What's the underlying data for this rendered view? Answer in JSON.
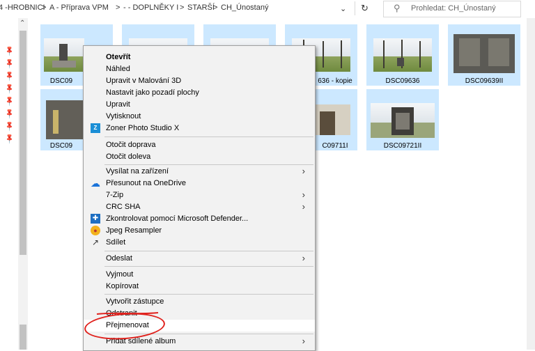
{
  "address_bar": {
    "breadcrumb": [
      "4 -HROBNICI",
      "A - Příprava VPM",
      "- - DOPLNĚKY I",
      "STARŠÍ",
      "CH_Únostaný"
    ],
    "separator": ">",
    "dropdown_icon": "chevron-down-icon",
    "refresh_icon": "refresh-icon",
    "search_placeholder": "Prohledat: CH_Únostaný"
  },
  "files": [
    {
      "name": "DSC09"
    },
    {
      "name": ""
    },
    {
      "name": ""
    },
    {
      "name": "636 - kopie"
    },
    {
      "name": "DSC09636"
    },
    {
      "name": "DSC09639II"
    },
    {
      "name": "DSC09"
    },
    {
      "name": "C09711I"
    },
    {
      "name": "DSC09721II"
    }
  ],
  "context_menu": {
    "items": [
      {
        "label": "Otevřít",
        "bold": true,
        "icon": ""
      },
      {
        "label": "Náhled",
        "icon": ""
      },
      {
        "label": "Upravit v Malování 3D",
        "icon": ""
      },
      {
        "label": "Nastavit jako pozadí plochy",
        "icon": ""
      },
      {
        "label": "Upravit",
        "icon": ""
      },
      {
        "label": "Vytisknout",
        "icon": ""
      },
      {
        "label": "Zoner Photo Studio X",
        "icon": "zoner-icon"
      },
      {
        "label": "Otočit doprava",
        "icon": ""
      },
      {
        "label": "Otočit doleva",
        "icon": ""
      },
      {
        "label": "Vysílat na zařízení",
        "icon": "",
        "submenu": true
      },
      {
        "label": "Přesunout na OneDrive",
        "icon": "onedrive-icon"
      },
      {
        "label": "7-Zip",
        "icon": "",
        "submenu": true
      },
      {
        "label": "CRC SHA",
        "icon": "",
        "submenu": true
      },
      {
        "label": "Zkontrolovat pomocí Microsoft Defender...",
        "icon": "defender-icon"
      },
      {
        "label": "Jpeg Resampler",
        "icon": "jpeg-resampler-icon"
      },
      {
        "label": "Sdílet",
        "icon": "share-icon"
      },
      {
        "label": "Odeslat",
        "icon": "",
        "submenu": true
      },
      {
        "label": "Vyjmout",
        "icon": ""
      },
      {
        "label": "Kopírovat",
        "icon": ""
      },
      {
        "label": "Vytvořit zástupce",
        "icon": ""
      },
      {
        "label": "Odstranit",
        "icon": ""
      },
      {
        "label": "Přejmenovat",
        "icon": "",
        "highlighted": true
      },
      {
        "label": "Přidat sdílené album",
        "icon": "",
        "submenu": true
      }
    ],
    "submenu_arrow": "›"
  },
  "annotation": {
    "color": "#e0211c",
    "target": "Přejmenovat"
  },
  "colors": {
    "selection": "#cce8ff",
    "menu_bg": "#f2f2f2",
    "menu_highlight": "#ffffff"
  }
}
